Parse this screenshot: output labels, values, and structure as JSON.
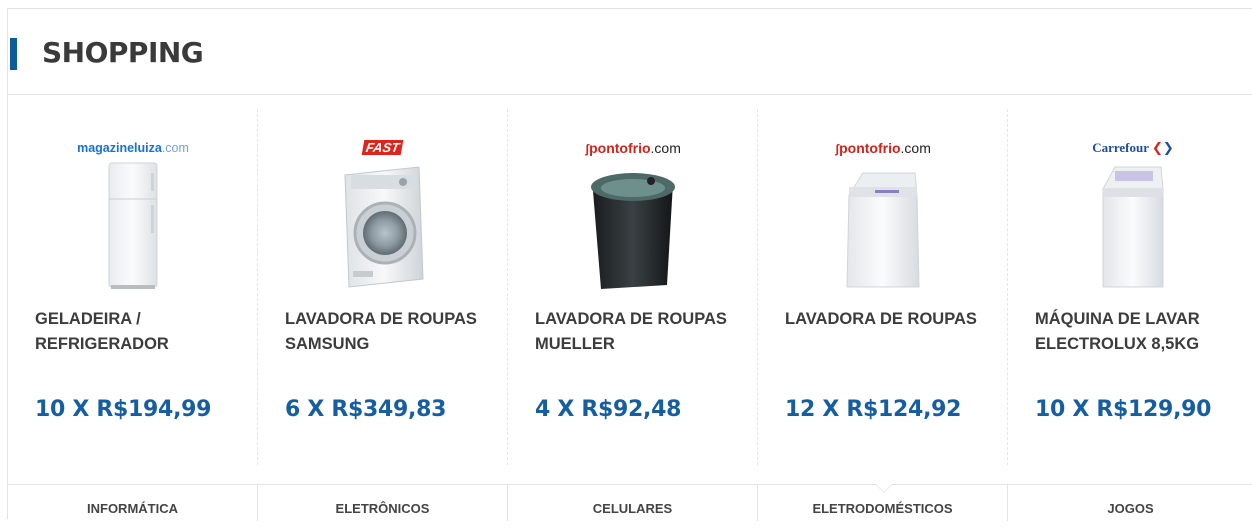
{
  "header": {
    "title": "SHOPPING"
  },
  "products": [
    {
      "store": {
        "name": "magazineluiza",
        "suffix": ".com"
      },
      "name": "GELADEIRA / REFRIGERADOR",
      "price": "10 X R$194,99",
      "image": "refrigerator-image"
    },
    {
      "store": {
        "name": "FAST"
      },
      "name": "LAVADORA DE ROUPAS SAMSUNG",
      "price": "6 X R$349,83",
      "image": "front-load-washer-image"
    },
    {
      "store": {
        "name": "pontofrio",
        "suffix": ".com"
      },
      "name": "LAVADORA DE ROUPAS MUELLER",
      "price": "4 X R$92,48",
      "image": "black-top-load-washer-image"
    },
    {
      "store": {
        "name": "pontofrio",
        "suffix": ".com"
      },
      "name": "LAVADORA DE ROUPAS",
      "price": "12 X R$124,92",
      "image": "white-top-load-washer-image"
    },
    {
      "store": {
        "name": "Carrefour"
      },
      "name": "MÁQUINA DE LAVAR ELECTROLUX 8,5KG",
      "price": "10 X R$129,90",
      "image": "electrolux-washer-image"
    }
  ],
  "tabs": [
    {
      "label": "INFORMÁTICA"
    },
    {
      "label": "ELETRÔNICOS"
    },
    {
      "label": "CELULARES"
    },
    {
      "label": "ELETRODOMÉSTICOS"
    },
    {
      "label": "JOGOS"
    }
  ],
  "colors": {
    "accent": "#0f5a99",
    "price": "#155ea1",
    "border": "#e3e3e3"
  }
}
